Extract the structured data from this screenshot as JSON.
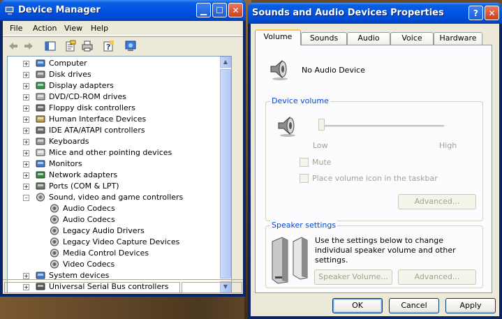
{
  "device_manager": {
    "title": "Device Manager",
    "menu": [
      "File",
      "Action",
      "View",
      "Help"
    ],
    "toolbar_icons": [
      "back-arrow-icon",
      "forward-arrow-icon",
      "console-tree-icon",
      "properties-icon",
      "print-icon",
      "help-icon",
      "scan-hardware-icon"
    ],
    "tree": [
      {
        "label": "Computer",
        "indent": 0,
        "expander": "+",
        "icon": "computer-icon"
      },
      {
        "label": "Disk drives",
        "indent": 0,
        "expander": "+",
        "icon": "disk-drive-icon"
      },
      {
        "label": "Display adapters",
        "indent": 0,
        "expander": "+",
        "icon": "display-adapter-icon"
      },
      {
        "label": "DVD/CD-ROM drives",
        "indent": 0,
        "expander": "+",
        "icon": "cd-drive-icon"
      },
      {
        "label": "Floppy disk controllers",
        "indent": 0,
        "expander": "+",
        "icon": "floppy-controller-icon"
      },
      {
        "label": "Human Interface Devices",
        "indent": 0,
        "expander": "+",
        "icon": "hid-icon"
      },
      {
        "label": "IDE ATA/ATAPI controllers",
        "indent": 0,
        "expander": "+",
        "icon": "ide-controller-icon"
      },
      {
        "label": "Keyboards",
        "indent": 0,
        "expander": "+",
        "icon": "keyboard-icon"
      },
      {
        "label": "Mice and other pointing devices",
        "indent": 0,
        "expander": "+",
        "icon": "mouse-icon"
      },
      {
        "label": "Monitors",
        "indent": 0,
        "expander": "+",
        "icon": "monitor-icon"
      },
      {
        "label": "Network adapters",
        "indent": 0,
        "expander": "+",
        "icon": "network-adapter-icon"
      },
      {
        "label": "Ports (COM & LPT)",
        "indent": 0,
        "expander": "+",
        "icon": "port-icon"
      },
      {
        "label": "Sound, video and game controllers",
        "indent": 0,
        "expander": "-",
        "icon": "sound-controller-icon"
      },
      {
        "label": "Audio Codecs",
        "indent": 1,
        "expander": "",
        "icon": "speaker-icon"
      },
      {
        "label": "Audio Codecs",
        "indent": 1,
        "expander": "",
        "icon": "speaker-icon"
      },
      {
        "label": "Legacy Audio Drivers",
        "indent": 1,
        "expander": "",
        "icon": "speaker-icon"
      },
      {
        "label": "Legacy Video Capture Devices",
        "indent": 1,
        "expander": "",
        "icon": "speaker-icon"
      },
      {
        "label": "Media Control Devices",
        "indent": 1,
        "expander": "",
        "icon": "speaker-icon"
      },
      {
        "label": "Video Codecs",
        "indent": 1,
        "expander": "",
        "icon": "speaker-icon"
      },
      {
        "label": "System devices",
        "indent": 0,
        "expander": "+",
        "icon": "computer-icon"
      },
      {
        "label": "Universal Serial Bus controllers",
        "indent": 0,
        "expander": "+",
        "icon": "usb-icon"
      }
    ]
  },
  "sound_properties": {
    "title": "Sounds and Audio Devices Properties",
    "tabs": [
      "Volume",
      "Sounds",
      "Audio",
      "Voice",
      "Hardware"
    ],
    "active_tab": "Volume",
    "device_name": "No Audio Device",
    "device_volume_legend": "Device volume",
    "low_label": "Low",
    "high_label": "High",
    "volume_level": 0,
    "mute_label": "Mute",
    "taskbar_icon_label": "Place volume icon in the taskbar",
    "advanced_label": "Advanced...",
    "speaker_legend": "Speaker settings",
    "speaker_text": "Use the settings below to change individual speaker volume and other settings.",
    "speaker_volume_label": "Speaker Volume...",
    "speaker_advanced_label": "Advanced...",
    "ok_label": "OK",
    "cancel_label": "Cancel",
    "apply_label": "Apply"
  }
}
